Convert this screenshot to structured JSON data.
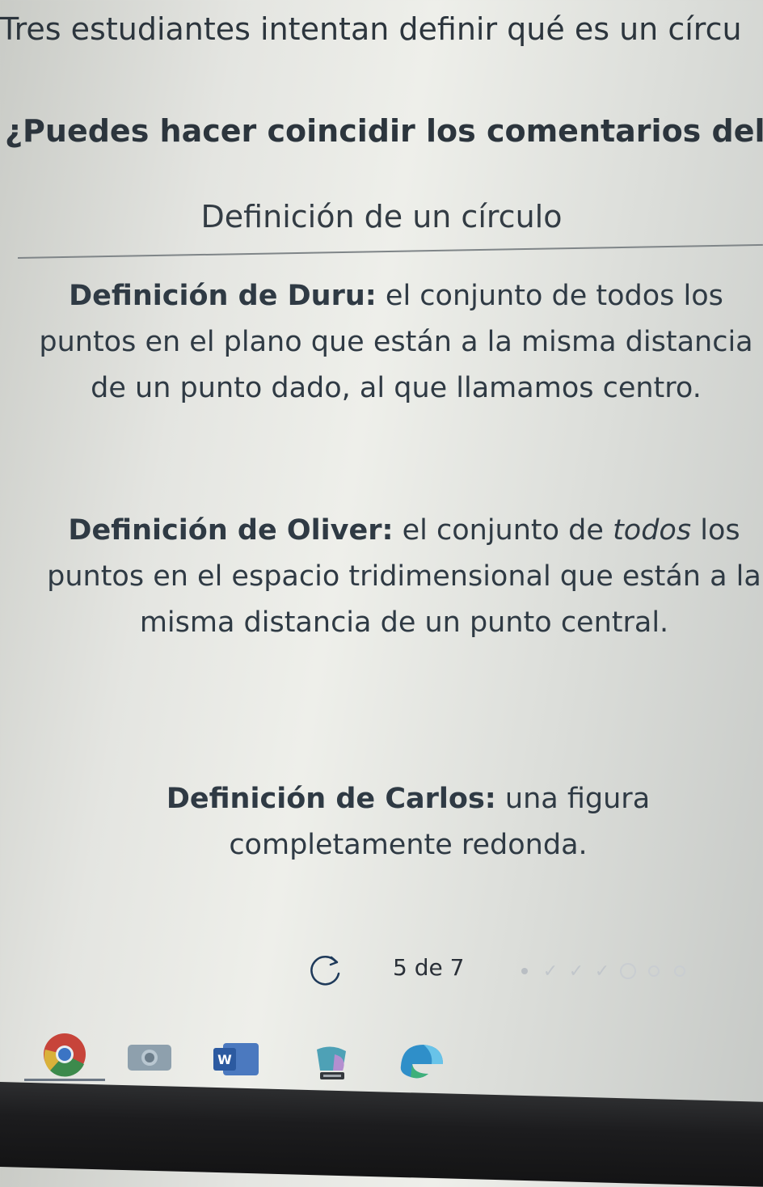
{
  "question": {
    "title": "Tres estudiantes intentan definir qué es un círcu",
    "prompt": "¿Puedes hacer coincidir los comentarios del pro"
  },
  "section": {
    "heading": "Definición de un círculo"
  },
  "definitions": [
    {
      "who": "Definición de Duru:",
      "text": "el conjunto de todos los puntos en el plano que están a la misma distancia de un punto dado, al que llamamos centro."
    },
    {
      "who": "Definición de Oliver:",
      "text_before": "el conjunto de",
      "text_italic": "todos",
      "text_after": "los puntos en el espacio tridimensional que están a la misma distancia de un punto central."
    },
    {
      "who": "Definición de Carlos:",
      "text": "una figura completamente redonda."
    }
  ],
  "pager": {
    "counter": "5 de 7",
    "current": 5,
    "total": 7
  },
  "taskbar": {
    "icons": [
      "chrome-icon",
      "camera-icon",
      "word-icon",
      "app-icon",
      "edge-icon"
    ]
  }
}
